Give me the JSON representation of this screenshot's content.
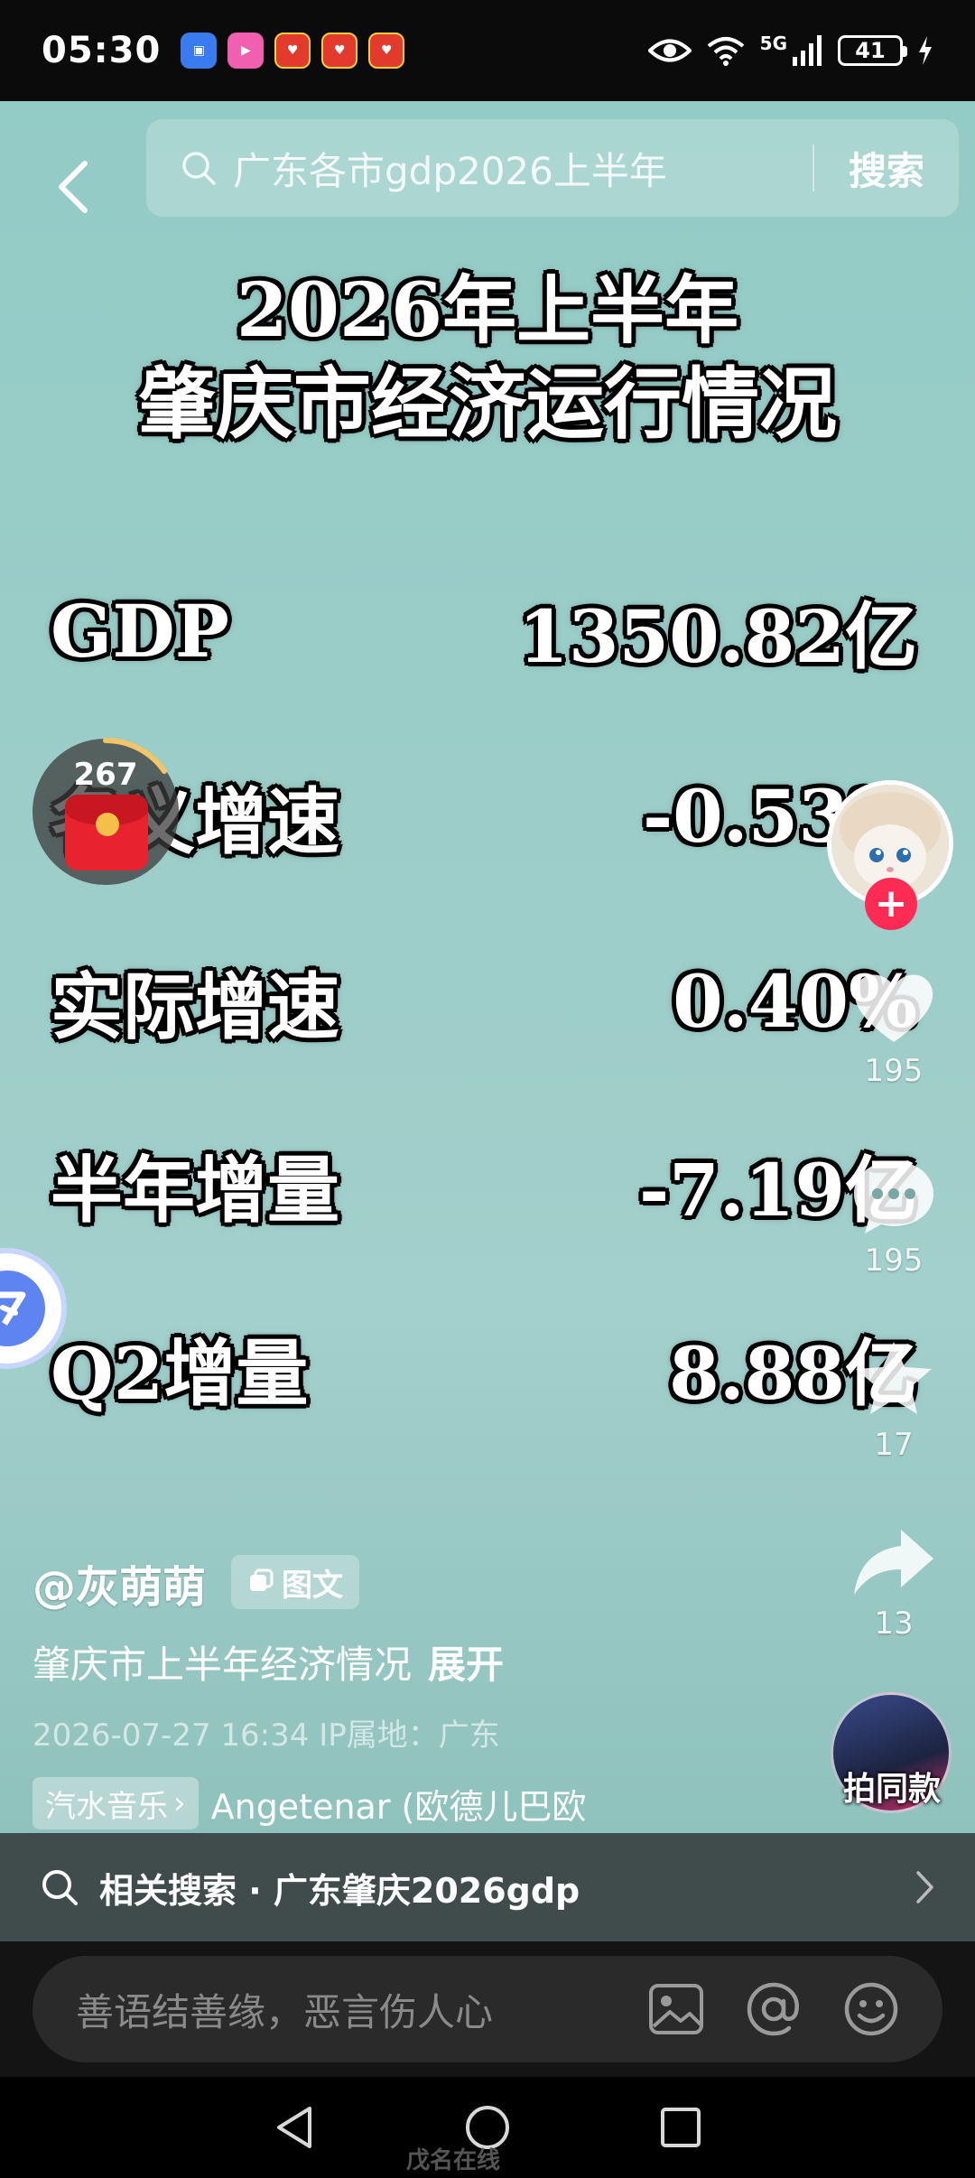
{
  "status_bar": {
    "time": "05:30",
    "network": "5G",
    "battery": "41"
  },
  "search": {
    "query": "广东各市gdp2026上半年",
    "button": "搜索"
  },
  "poster": {
    "title_line1": "2026年上半年",
    "title_line2": "肇庆市经济运行情况",
    "rows": [
      {
        "label": "GDP",
        "value": "1350.82亿"
      },
      {
        "label": "名义增速",
        "value": "-0.53%"
      },
      {
        "label": "实际增速",
        "value": "0.40%"
      },
      {
        "label": "半年增量",
        "value": "-7.19亿"
      },
      {
        "label": "Q2增量",
        "value": "8.88亿"
      }
    ]
  },
  "red_packet": {
    "count": "267"
  },
  "actions": {
    "likes": "195",
    "comments": "195",
    "favorites": "17",
    "shares": "13",
    "same_style": "拍同款"
  },
  "post": {
    "author": "@灰萌萌",
    "badge": "图文",
    "caption": "肇庆市上半年经济情况",
    "expand": "展开",
    "meta": "2026-07-27 16:34  IP属地：广东",
    "music_tag": "汽水音乐",
    "music_title": "Angetenar (欧德儿巴欧"
  },
  "related": {
    "text": "相关搜索 · 广东肇庆2026gdp"
  },
  "comment": {
    "placeholder": "善语结善缘，恶言伤人心"
  },
  "watermark": "戊名在线"
}
